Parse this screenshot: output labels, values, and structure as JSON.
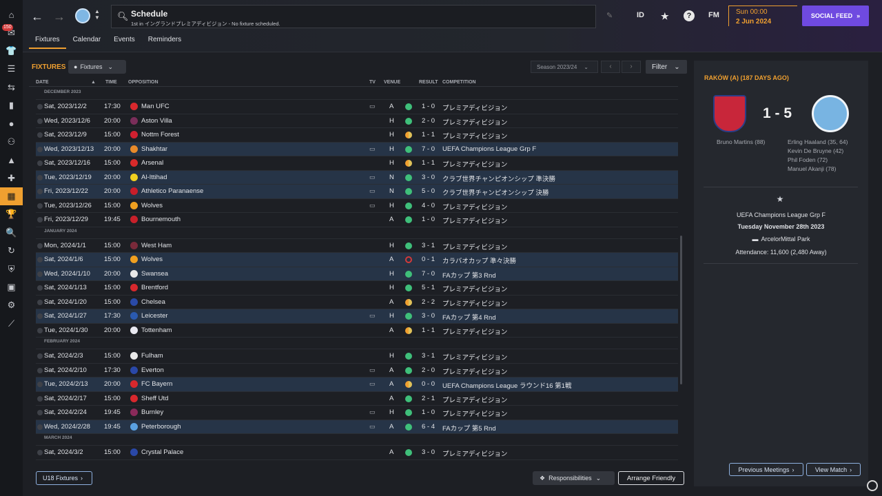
{
  "nav": {
    "badge": "150",
    "icons": [
      "home-icon",
      "inbox-icon",
      "kit-icon",
      "squad-icon",
      "tactics-icon",
      "data-icon",
      "training-icon",
      "staff-icon",
      "competitions-icon",
      "medical-icon",
      "schedule-icon",
      "trophy-icon",
      "scouting-icon",
      "transfers-icon",
      "club-info-icon",
      "finances-icon",
      "dev-centre-icon",
      "report-icon"
    ]
  },
  "header": {
    "title": "Schedule",
    "subtitle": "1st in イングランドプレミアディビジョン - No fixture scheduled.",
    "id_label": "ID",
    "fm_label": "FM",
    "help_label": "?",
    "day": "Sun 00:00",
    "date": "2 Jun 2024",
    "social": "SOCIAL FEED"
  },
  "tabs": [
    "Fixtures",
    "Calendar",
    "Events",
    "Reminders"
  ],
  "fixtures": {
    "title": "FIXTURES",
    "dropdown": "Fixtures",
    "season": "Season 2023/24",
    "filter": "Filter",
    "columns": {
      "date": "DATE",
      "time": "TIME",
      "opposition": "OPPOSITION",
      "tv": "TV",
      "venue": "VENUE",
      "result": "RESULT",
      "competition": "COMPETITION"
    },
    "groups": [
      {
        "month": "DECEMBER 2023",
        "rows": [
          {
            "date": "Sat, 2023/12/2",
            "time": "17:30",
            "opp": "Man UFC",
            "tv": true,
            "venue": "A",
            "res": "w",
            "score": "1 - 0",
            "comp": "プレミアディビジョン",
            "hl": false,
            "crest": "#d8282d"
          },
          {
            "date": "Wed, 2023/12/6",
            "time": "20:00",
            "opp": "Aston Villa",
            "tv": false,
            "venue": "H",
            "res": "w",
            "score": "2 - 0",
            "comp": "プレミアディビジョン",
            "hl": false,
            "crest": "#7a2e5a"
          },
          {
            "date": "Sat, 2023/12/9",
            "time": "15:00",
            "opp": "Nottm Forest",
            "tv": false,
            "venue": "H",
            "res": "d",
            "score": "1 - 1",
            "comp": "プレミアディビジョン",
            "hl": false,
            "crest": "#d02030"
          },
          {
            "date": "Wed, 2023/12/13",
            "time": "20:00",
            "opp": "Shakhtar",
            "tv": true,
            "venue": "H",
            "res": "w",
            "score": "7 - 0",
            "comp": "UEFA Champions League Grp F",
            "hl": true,
            "crest": "#e88a2a"
          },
          {
            "date": "Sat, 2023/12/16",
            "time": "15:00",
            "opp": "Arsenal",
            "tv": false,
            "venue": "H",
            "res": "d",
            "score": "1 - 1",
            "comp": "プレミアディビジョン",
            "hl": false,
            "crest": "#d82a2a"
          },
          {
            "date": "Tue, 2023/12/19",
            "time": "20:00",
            "opp": "Al-Ittihad",
            "tv": true,
            "venue": "N",
            "res": "w",
            "score": "3 - 0",
            "comp": "クラブ世界チャンピオンシップ 準決勝",
            "hl": true,
            "crest": "#f0d020"
          },
          {
            "date": "Fri, 2023/12/22",
            "time": "20:00",
            "opp": "Athletico Paranaense",
            "tv": true,
            "venue": "N",
            "res": "w",
            "score": "5 - 0",
            "comp": "クラブ世界チャンピオンシップ 決勝",
            "hl": true,
            "crest": "#c81e2a"
          },
          {
            "date": "Tue, 2023/12/26",
            "time": "15:00",
            "opp": "Wolves",
            "tv": true,
            "venue": "H",
            "res": "w",
            "score": "4 - 0",
            "comp": "プレミアディビジョン",
            "hl": false,
            "crest": "#f0a020"
          },
          {
            "date": "Fri, 2023/12/29",
            "time": "19:45",
            "opp": "Bournemouth",
            "tv": false,
            "venue": "A",
            "res": "w",
            "score": "1 - 0",
            "comp": "プレミアディビジョン",
            "hl": false,
            "crest": "#c8202a"
          }
        ]
      },
      {
        "month": "JANUARY 2024",
        "rows": [
          {
            "date": "Mon, 2024/1/1",
            "time": "15:00",
            "opp": "West Ham",
            "tv": false,
            "venue": "H",
            "res": "w",
            "score": "3 - 1",
            "comp": "プレミアディビジョン",
            "hl": false,
            "crest": "#7a2a3a"
          },
          {
            "date": "Sat, 2024/1/6",
            "time": "15:00",
            "opp": "Wolves",
            "tv": false,
            "venue": "A",
            "res": "l",
            "score": "0 - 1",
            "comp": "カラバオカップ 準々決勝",
            "hl": true,
            "crest": "#f0a020"
          },
          {
            "date": "Wed, 2024/1/10",
            "time": "20:00",
            "opp": "Swansea",
            "tv": false,
            "venue": "H",
            "res": "w",
            "score": "7 - 0",
            "comp": "FAカップ 第3 Rnd",
            "hl": true,
            "crest": "#e8e8e8"
          },
          {
            "date": "Sat, 2024/1/13",
            "time": "15:00",
            "opp": "Brentford",
            "tv": false,
            "venue": "H",
            "res": "w",
            "score": "5 - 1",
            "comp": "プレミアディビジョン",
            "hl": false,
            "crest": "#d8282d"
          },
          {
            "date": "Sat, 2024/1/20",
            "time": "15:00",
            "opp": "Chelsea",
            "tv": false,
            "venue": "A",
            "res": "d",
            "score": "2 - 2",
            "comp": "プレミアディビジョン",
            "hl": false,
            "crest": "#2a4aa8"
          },
          {
            "date": "Sat, 2024/1/27",
            "time": "17:30",
            "opp": "Leicester",
            "tv": true,
            "venue": "H",
            "res": "w",
            "score": "3 - 0",
            "comp": "FAカップ 第4 Rnd",
            "hl": true,
            "crest": "#2a5ab0"
          },
          {
            "date": "Tue, 2024/1/30",
            "time": "20:00",
            "opp": "Tottenham",
            "tv": false,
            "venue": "A",
            "res": "d",
            "score": "1 - 1",
            "comp": "プレミアディビジョン",
            "hl": false,
            "crest": "#e8e8f0"
          }
        ]
      },
      {
        "month": "FEBRUARY 2024",
        "rows": [
          {
            "date": "Sat, 2024/2/3",
            "time": "15:00",
            "opp": "Fulham",
            "tv": false,
            "venue": "H",
            "res": "w",
            "score": "3 - 1",
            "comp": "プレミアディビジョン",
            "hl": false,
            "crest": "#e8e8e8"
          },
          {
            "date": "Sat, 2024/2/10",
            "time": "17:30",
            "opp": "Everton",
            "tv": true,
            "venue": "A",
            "res": "w",
            "score": "2 - 0",
            "comp": "プレミアディビジョン",
            "hl": false,
            "crest": "#2a48a8"
          },
          {
            "date": "Tue, 2024/2/13",
            "time": "20:00",
            "opp": "FC Bayern",
            "tv": true,
            "venue": "A",
            "res": "d",
            "score": "0 - 0",
            "comp": "UEFA Champions League ラウンド16 第1戦",
            "hl": true,
            "crest": "#d8282d"
          },
          {
            "date": "Sat, 2024/2/17",
            "time": "15:00",
            "opp": "Sheff Utd",
            "tv": false,
            "venue": "A",
            "res": "w",
            "score": "2 - 1",
            "comp": "プレミアディビジョン",
            "hl": false,
            "crest": "#d8282d"
          },
          {
            "date": "Sat, 2024/2/24",
            "time": "19:45",
            "opp": "Burnley",
            "tv": true,
            "venue": "H",
            "res": "w",
            "score": "1 - 0",
            "comp": "プレミアディビジョン",
            "hl": false,
            "crest": "#8a2a5a"
          },
          {
            "date": "Wed, 2024/2/28",
            "time": "19:45",
            "opp": "Peterborough",
            "tv": true,
            "venue": "A",
            "res": "w",
            "score": "6 - 4",
            "comp": "FAカップ 第5 Rnd",
            "hl": true,
            "crest": "#5aa0e0"
          }
        ]
      },
      {
        "month": "MARCH 2024",
        "rows": [
          {
            "date": "Sat, 2024/3/2",
            "time": "15:00",
            "opp": "Crystal Palace",
            "tv": false,
            "venue": "A",
            "res": "w",
            "score": "3 - 0",
            "comp": "プレミアディビジョン",
            "hl": false,
            "crest": "#2a48a8"
          }
        ]
      }
    ],
    "u18": "U18 Fixtures",
    "responsibilities": "Responsibilities",
    "arrange": "Arrange Friendly"
  },
  "match": {
    "title": "RAKÓW (A) (187 DAYS AGO)",
    "score": "1 - 5",
    "home_scorers": [
      "Bruno Martins (88)"
    ],
    "away_scorers": [
      "Erling Haaland (35, 64)",
      "Kevin De Bruyne (42)",
      "Phil Foden (72)",
      "Manuel Akanji (78)"
    ],
    "competition": "UEFA Champions League Grp F",
    "date": "Tuesday November 28th 2023",
    "stadium": "ArcelorMittal Park",
    "attendance": "Attendance: 11,600 (2,480 Away)",
    "prev": "Previous Meetings",
    "view": "View Match"
  }
}
